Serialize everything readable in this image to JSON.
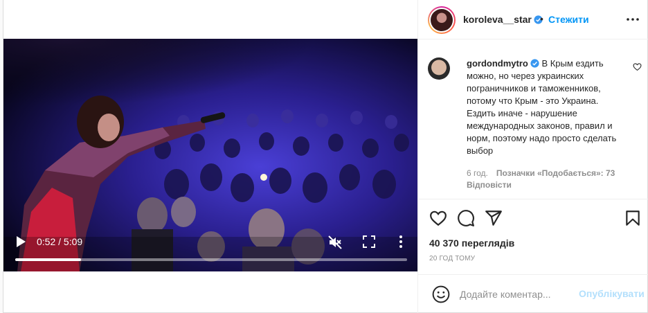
{
  "post": {
    "header": {
      "username": "koroleva__star",
      "separator": "•",
      "follow_label": "Стежити",
      "more_icon": "more-horizontal-icon"
    },
    "video": {
      "time": "0:52 / 5:09",
      "progress": 0.168,
      "play_icon": "play-icon",
      "mute_icon": "muted-speaker-icon",
      "fullscreen_icon": "fullscreen-icon",
      "more_icon": "more-vertical-icon"
    },
    "comment": {
      "username": "gordondmytro",
      "text": "В Крым ездить можно, но через украинских пограничников и таможенников, потому что Крым - это Украина. Ездить иначе - нарушение международных законов, правил и норм, поэтому надо просто сделать выбор",
      "time": "6 год.",
      "likes": "Позначки «Подобається»: 73",
      "replies": "Відповісти"
    },
    "actions": {
      "like_icon": "heart-icon",
      "comment_icon": "comment-icon",
      "share_icon": "send-icon",
      "save_icon": "bookmark-icon"
    },
    "views": "40 370 переглядів",
    "posted": "20 ГОД ТОМУ",
    "add_comment": {
      "placeholder": "Додайте коментар...",
      "post_label": "Опублікувати",
      "emoji_icon": "emoji-icon"
    },
    "colors": {
      "accent": "#0095f6",
      "post_disabled": "#b2dffc",
      "verified": "#3897f0",
      "muted_text": "#8e8e8e"
    }
  }
}
